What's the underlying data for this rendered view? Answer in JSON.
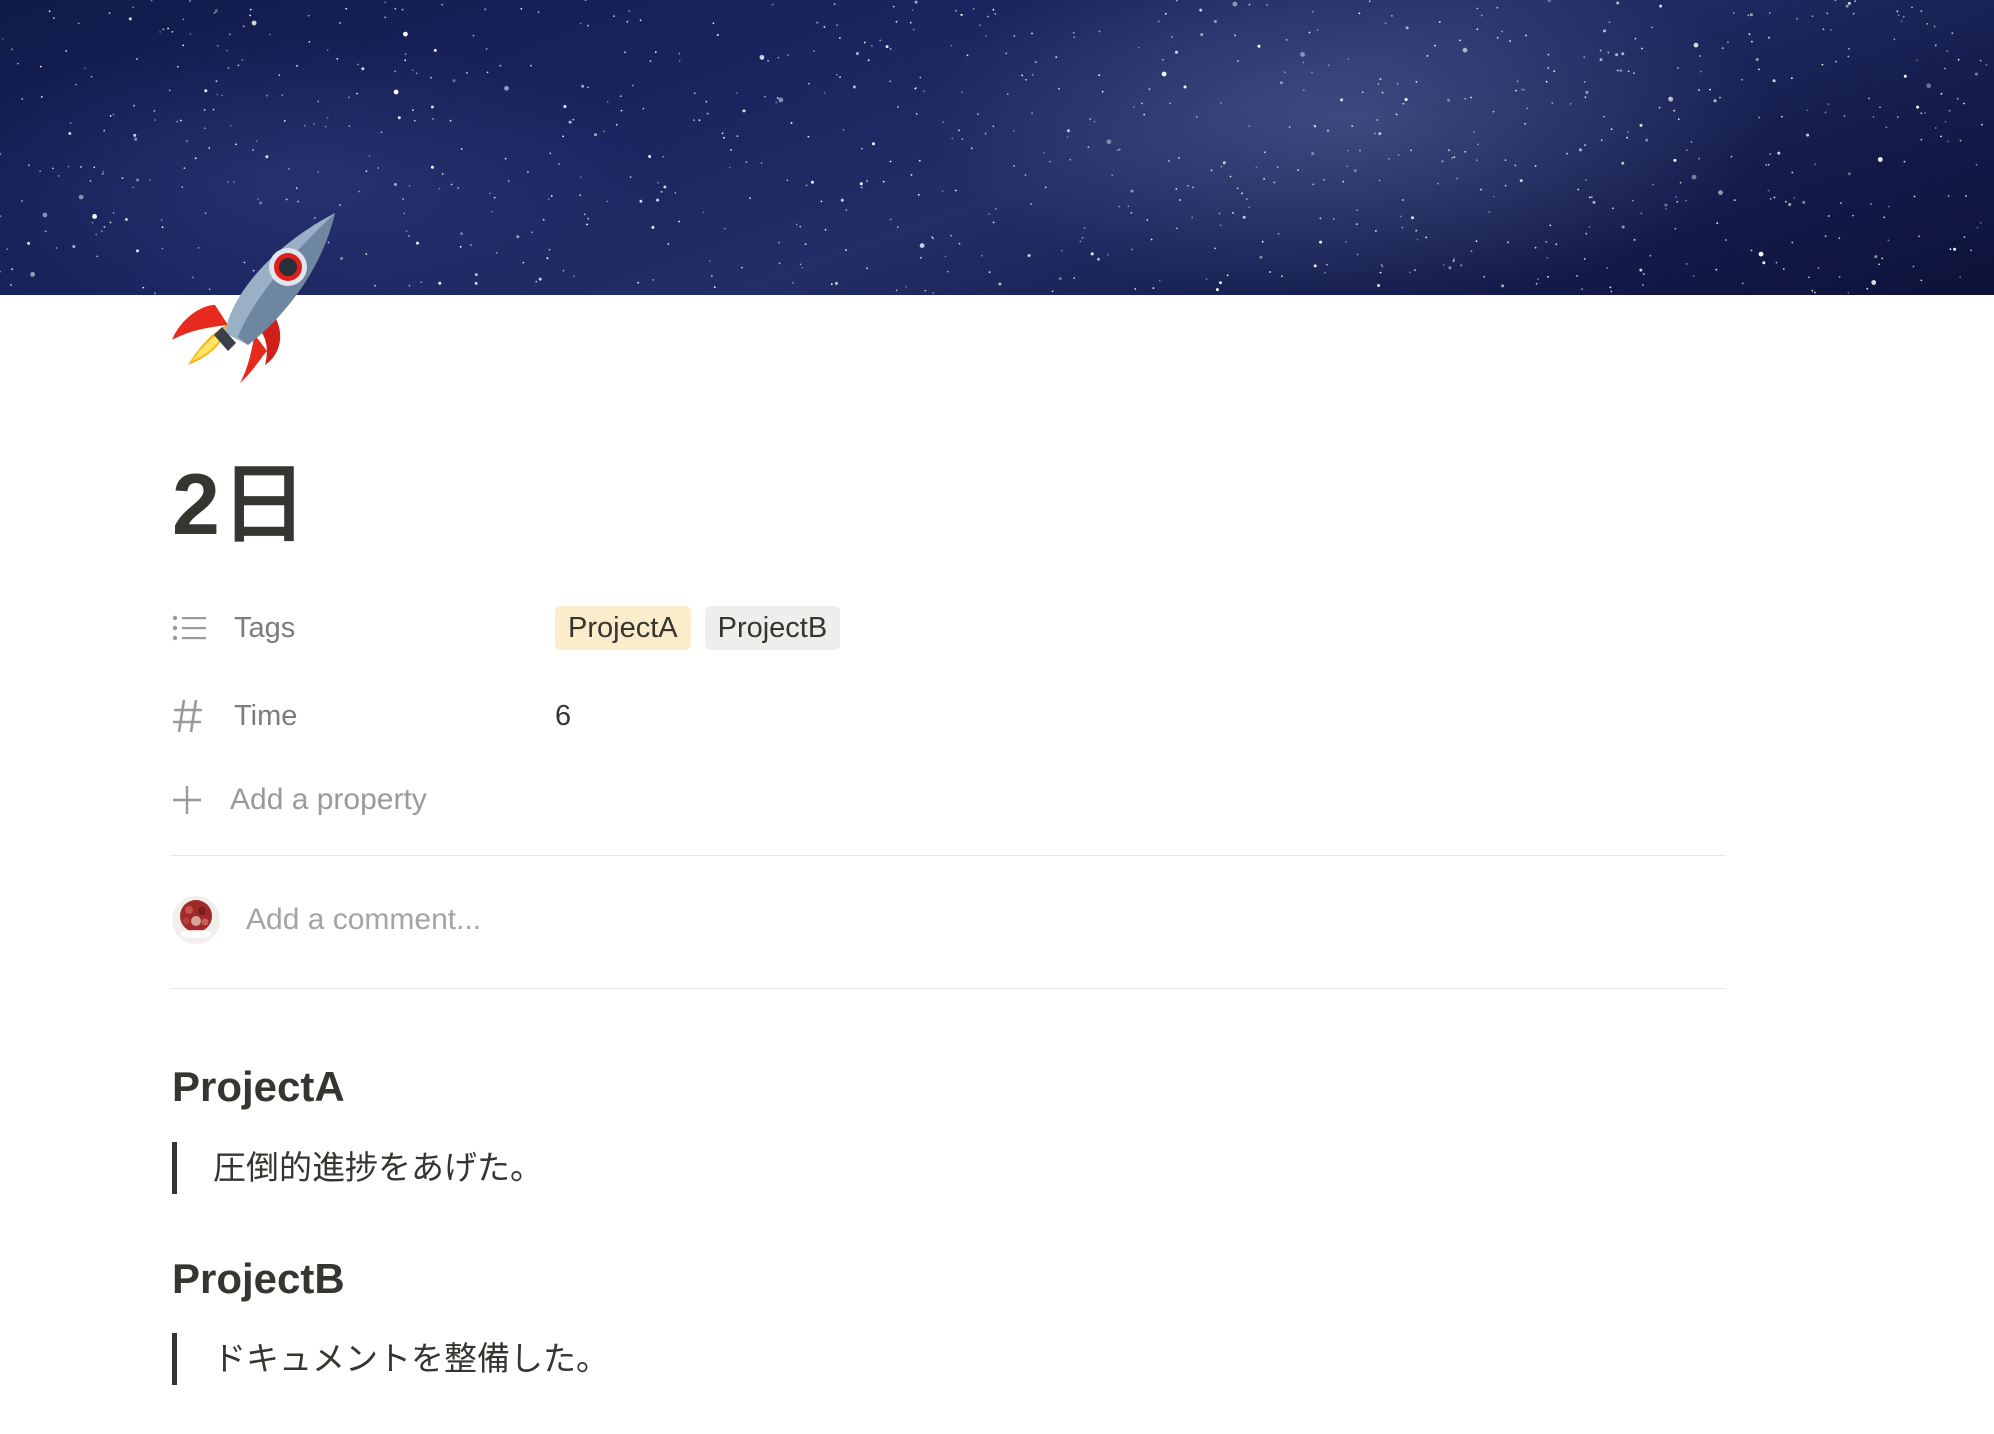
{
  "page": {
    "title": "2日",
    "icon": "rocket-emoji"
  },
  "properties": {
    "tags": {
      "label": "Tags",
      "icon": "list-icon",
      "values": [
        "ProjectA",
        "ProjectB"
      ],
      "colors": [
        "#fbeccc",
        "#efeeec"
      ]
    },
    "time": {
      "label": "Time",
      "icon": "number-icon",
      "value": "6"
    },
    "add_property_label": "Add a property"
  },
  "comment": {
    "placeholder": "Add a comment..."
  },
  "content": {
    "sections": [
      {
        "heading": "ProjectA",
        "quote": "圧倒的進捗をあげた。"
      },
      {
        "heading": "ProjectB",
        "quote": "ドキュメントを整備した。"
      }
    ]
  },
  "colors": {
    "text": "#37352f",
    "muted": "#9b9a97",
    "divider": "#e9e9e7"
  }
}
